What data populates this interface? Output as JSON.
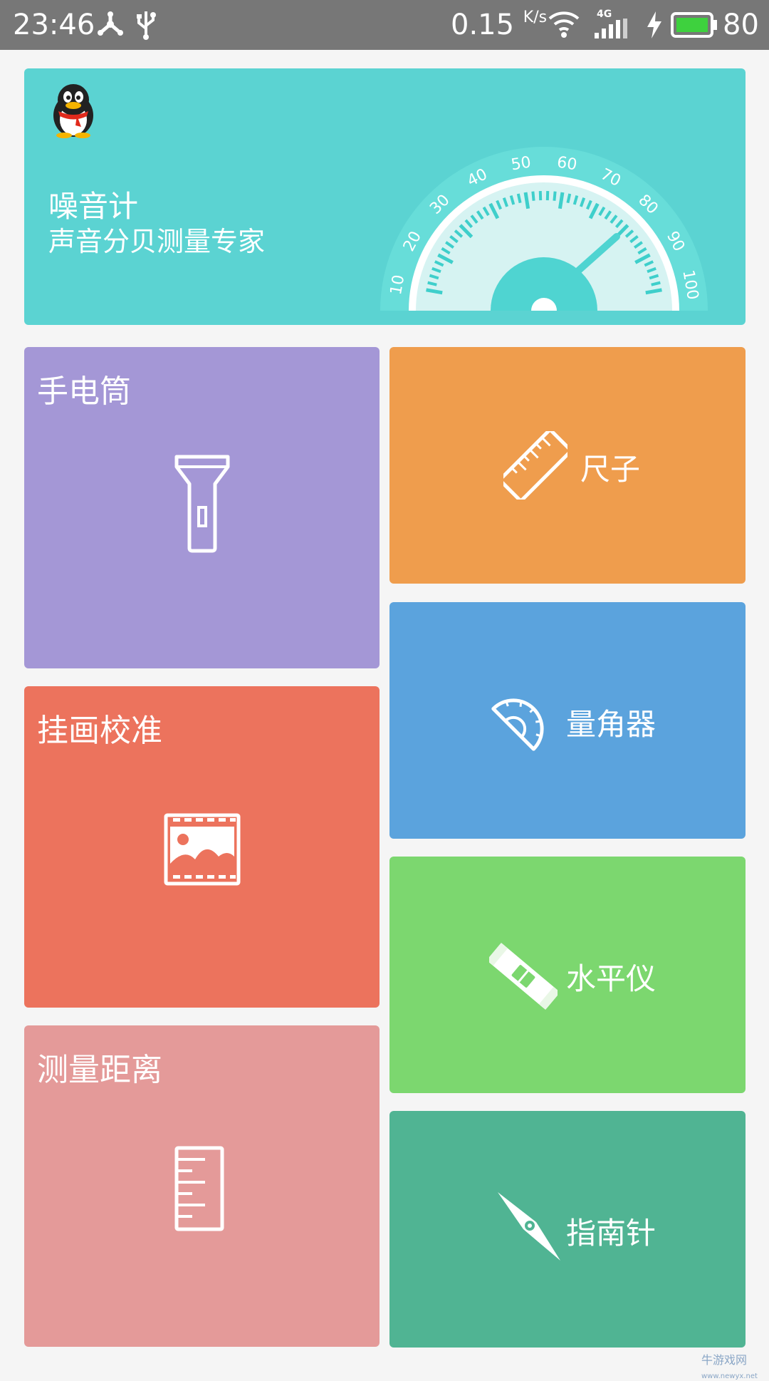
{
  "status_bar": {
    "time": "23:46",
    "net_speed": "0.15",
    "net_speed_unit": "K/s",
    "network_type": "4G",
    "battery": "80",
    "icons": [
      "share-icon",
      "usb-icon",
      "wifi-icon",
      "signal-icon",
      "charging-icon",
      "battery-icon"
    ]
  },
  "noise_meter": {
    "logo": "penguin-logo",
    "title": "噪音计",
    "subtitle": "声音分贝测量专家",
    "gauge_ticks": [
      "10",
      "20",
      "30",
      "40",
      "50",
      "60",
      "70",
      "80",
      "90",
      "100"
    ]
  },
  "tiles": {
    "flashlight": {
      "label": "手电筒",
      "icon": "flashlight-icon"
    },
    "painting": {
      "label": "挂画校准",
      "icon": "picture-icon"
    },
    "distance": {
      "label": "测量距离",
      "icon": "measure-ruler-icon"
    },
    "ruler": {
      "label": "尺子",
      "icon": "ruler-icon"
    },
    "protractor": {
      "label": "量角器",
      "icon": "protractor-icon"
    },
    "level": {
      "label": "水平仪",
      "icon": "spirit-level-icon"
    },
    "compass": {
      "label": "指南针",
      "icon": "compass-icon"
    }
  },
  "watermark": {
    "name": "牛游戏网",
    "url": "www.newyx.net"
  },
  "colors": {
    "status_bar": "#777777",
    "noise": "#5bd3d2",
    "flashlight": "#a497d6",
    "painting": "#ec735d",
    "distance": "#e49a99",
    "ruler": "#ef9d4d",
    "protractor": "#5ba3dd",
    "level": "#7cd76f",
    "compass": "#50b493"
  }
}
